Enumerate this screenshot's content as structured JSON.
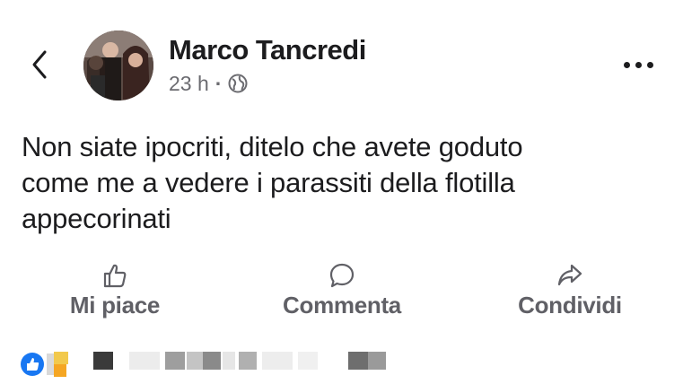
{
  "post": {
    "author": "Marco Tancredi",
    "time": "23 h",
    "separator": "·",
    "privacy_icon": "globe-icon",
    "text_lines": [
      "Non siate ipocriti, ditelo che avete goduto",
      "come me a vedere i parassiti della flotilla",
      "appecorinati"
    ]
  },
  "actions": {
    "like": {
      "label": "Mi piace",
      "icon": "thumbs-up-icon"
    },
    "comment": {
      "label": "Commenta",
      "icon": "speech-bubble-icon"
    },
    "share": {
      "label": "Condividi",
      "icon": "share-arrow-icon"
    }
  },
  "colors": {
    "text": "#1c1c1e",
    "secondary": "#606066",
    "like_blue": "#1877f2"
  }
}
